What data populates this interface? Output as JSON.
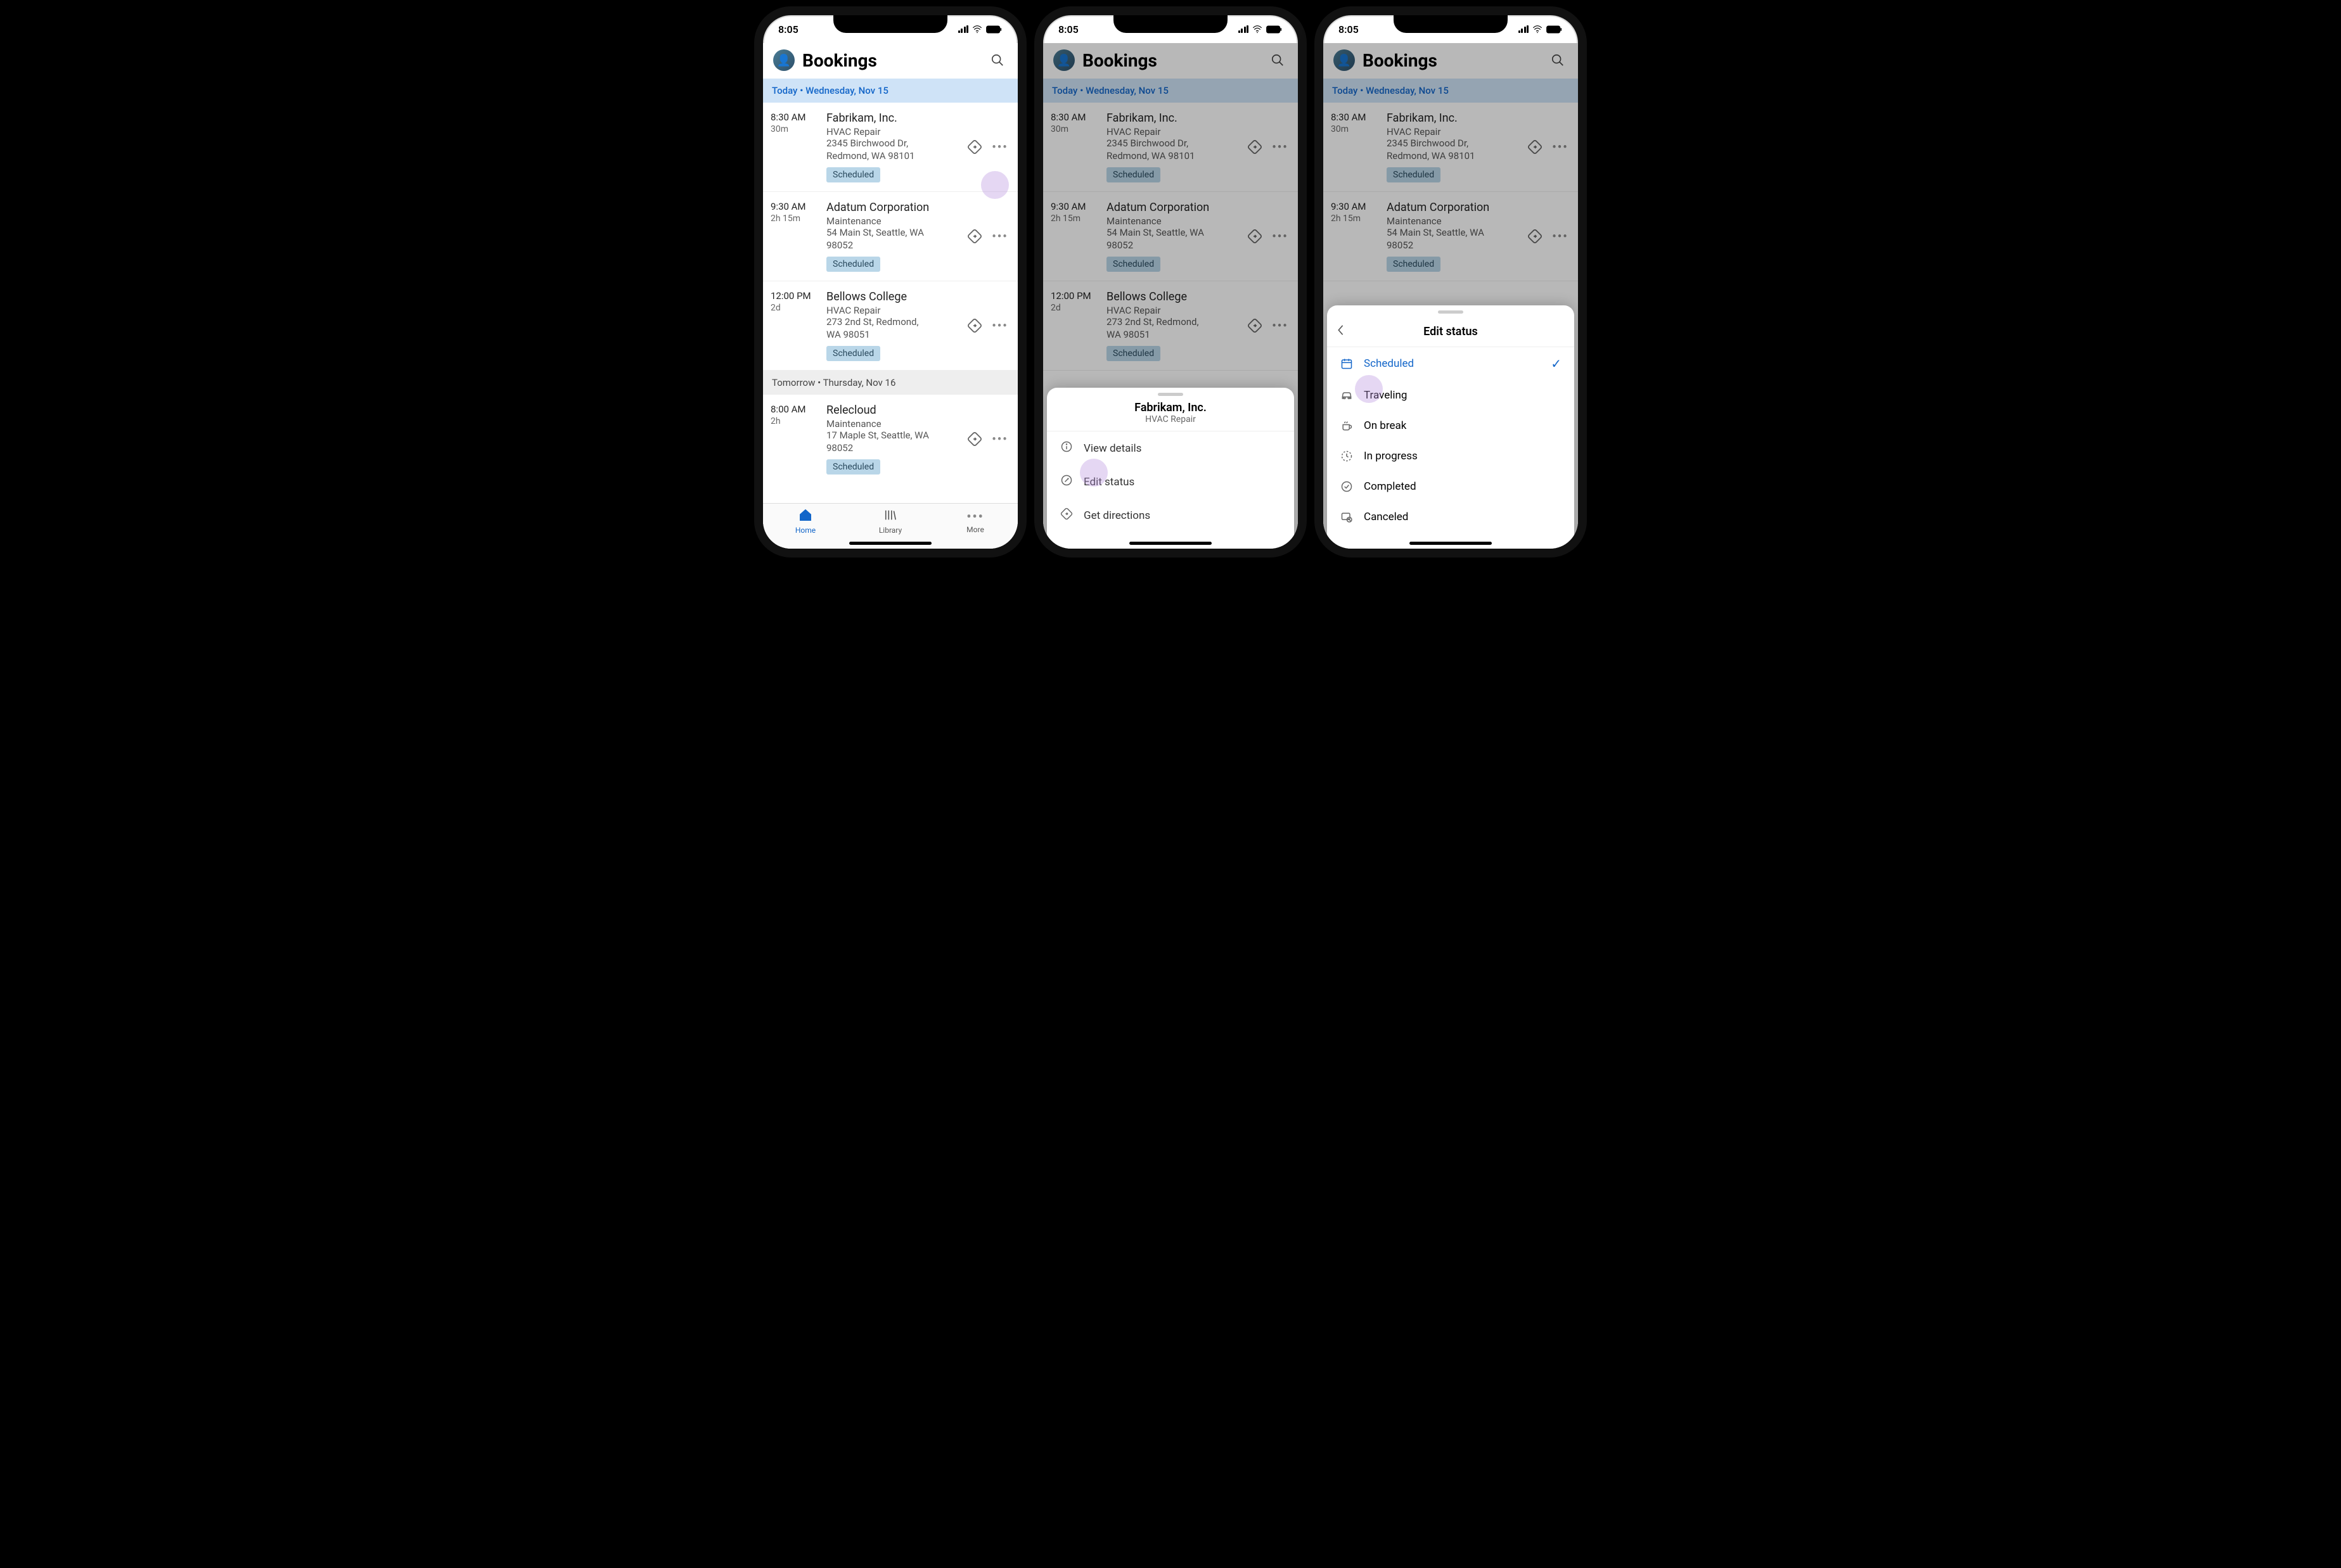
{
  "statusbar": {
    "time": "8:05"
  },
  "header": {
    "title": "Bookings"
  },
  "sections": {
    "today": {
      "prefix": "Today",
      "sep": "•",
      "date": "Wednesday, Nov 15"
    },
    "tomorrow": {
      "prefix": "Tomorrow",
      "sep": "•",
      "date": "Thursday, Nov 16"
    }
  },
  "bookings": [
    {
      "time": "8:30 AM",
      "duration": "30m",
      "customer": "Fabrikam, Inc.",
      "service": "HVAC Repair",
      "addr1": "2345 Birchwood Dr,",
      "addr2": "Redmond, WA 98101",
      "status": "Scheduled"
    },
    {
      "time": "9:30 AM",
      "duration": "2h 15m",
      "customer": "Adatum Corporation",
      "service": "Maintenance",
      "addr1": "54 Main St, Seattle, WA",
      "addr2": "98052",
      "status": "Scheduled"
    },
    {
      "time": "12:00 PM",
      "duration": "2d",
      "customer": "Bellows College",
      "service": "HVAC Repair",
      "addr1": "273 2nd St, Redmond,",
      "addr2": "WA 98051",
      "status": "Scheduled"
    },
    {
      "time": "8:00 AM",
      "duration": "2h",
      "customer": "Relecloud",
      "service": "Maintenance",
      "addr1": "17 Maple St, Seattle, WA",
      "addr2": "98052",
      "status": "Scheduled"
    }
  ],
  "tabs": {
    "home": "Home",
    "library": "Library",
    "more": "More"
  },
  "sheetMenu": {
    "title": "Fabrikam, Inc.",
    "subtitle": "HVAC Repair",
    "items": {
      "view": "View details",
      "edit": "Edit status",
      "directions": "Get directions"
    }
  },
  "editStatus": {
    "title": "Edit status",
    "options": {
      "scheduled": "Scheduled",
      "traveling": "Traveling",
      "onbreak": "On break",
      "inprogress": "In progress",
      "completed": "Completed",
      "canceled": "Canceled"
    }
  }
}
